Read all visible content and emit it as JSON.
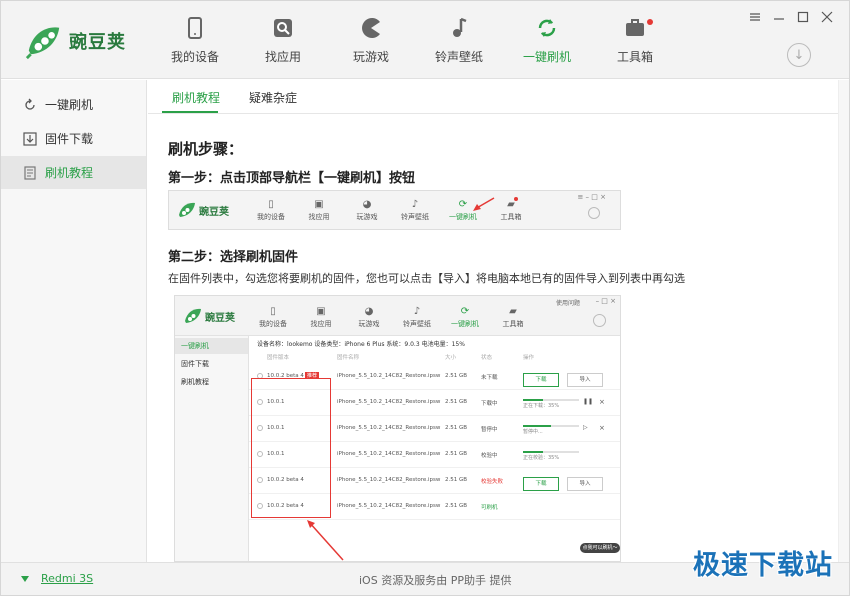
{
  "app": {
    "logo_text": "豌豆荚"
  },
  "nav": [
    {
      "label": "我的设备",
      "icon": "phone-icon"
    },
    {
      "label": "找应用",
      "icon": "search-icon"
    },
    {
      "label": "玩游戏",
      "icon": "pacman-icon"
    },
    {
      "label": "铃声壁纸",
      "icon": "music-note-icon"
    },
    {
      "label": "一键刷机",
      "icon": "refresh-icon",
      "active": true
    },
    {
      "label": "工具箱",
      "icon": "toolbox-icon"
    }
  ],
  "sidebar": {
    "items": [
      {
        "label": "一键刷机",
        "icon": "refresh-icon"
      },
      {
        "label": "固件下载",
        "icon": "download-icon"
      },
      {
        "label": "刷机教程",
        "icon": "book-icon",
        "active": true
      }
    ]
  },
  "tabs": [
    {
      "label": "刷机教程",
      "active": true
    },
    {
      "label": "疑难杂症"
    }
  ],
  "content": {
    "heading": "刷机步骤：",
    "step1": "第一步：点击顶部导航栏【一键刷机】按钮",
    "step2": "第二步：选择刷机固件",
    "step2_desc": "在固件列表中，勾选您将要刷机的固件，您也可以点击【导入】将电脑本地已有的固件导入到列表中再勾选"
  },
  "shot2": {
    "user_label": "使用问题",
    "device_info": "设备名称：lookemo      设备类型：iPhone 6 Plus      系统：9.0.3      电池电量：15%",
    "headers": [
      "固件版本",
      "固件名称",
      "大小",
      "状态",
      "操作"
    ],
    "rows": [
      {
        "version": "10.0.2 beta 4",
        "tag": "推荐",
        "name": "iPhone_5.5_10.2_14C82_Restore.ipsw",
        "size": "2.51 GB",
        "status": "未下载",
        "btn1": "下载",
        "btn2": "导入"
      },
      {
        "version": "10.0.1",
        "name": "iPhone_5.5_10.2_14C82_Restore.ipsw",
        "size": "2.51 GB",
        "status": "下载中",
        "progress_text": "正在下载：35%",
        "progress": 0.35
      },
      {
        "version": "10.0.1",
        "name": "iPhone_5.5_10.2_14C82_Restore.ipsw",
        "size": "2.51 GB",
        "status": "暂停中",
        "progress_text": "暂停中...",
        "progress": 0.5
      },
      {
        "version": "10.0.1",
        "name": "iPhone_5.5_10.2_14C82_Restore.ipsw",
        "size": "2.51 GB",
        "status": "校验中",
        "progress_text": "正在校验：35%",
        "progress": 0.35
      },
      {
        "version": "10.0.2 beta 4",
        "name": "iPhone_5.5_10.2_14C82_Restore.ipsw",
        "size": "2.51 GB",
        "status": "校验失败",
        "btn1": "下载",
        "btn2": "导入"
      },
      {
        "version": "10.0.2 beta 4",
        "name": "iPhone_5.5_10.2_14C82_Restore.ipsw",
        "size": "2.51 GB",
        "status": "可刷机"
      }
    ],
    "tip": "点我可以刷机～"
  },
  "footer": {
    "device": "Redmi 3S",
    "provider": "iOS 资源及服务由 PP助手 提供"
  },
  "watermark": "极速下载站",
  "colors": {
    "accent": "#2ba048",
    "red": "#e53935",
    "watermark": "#1b72b8"
  }
}
